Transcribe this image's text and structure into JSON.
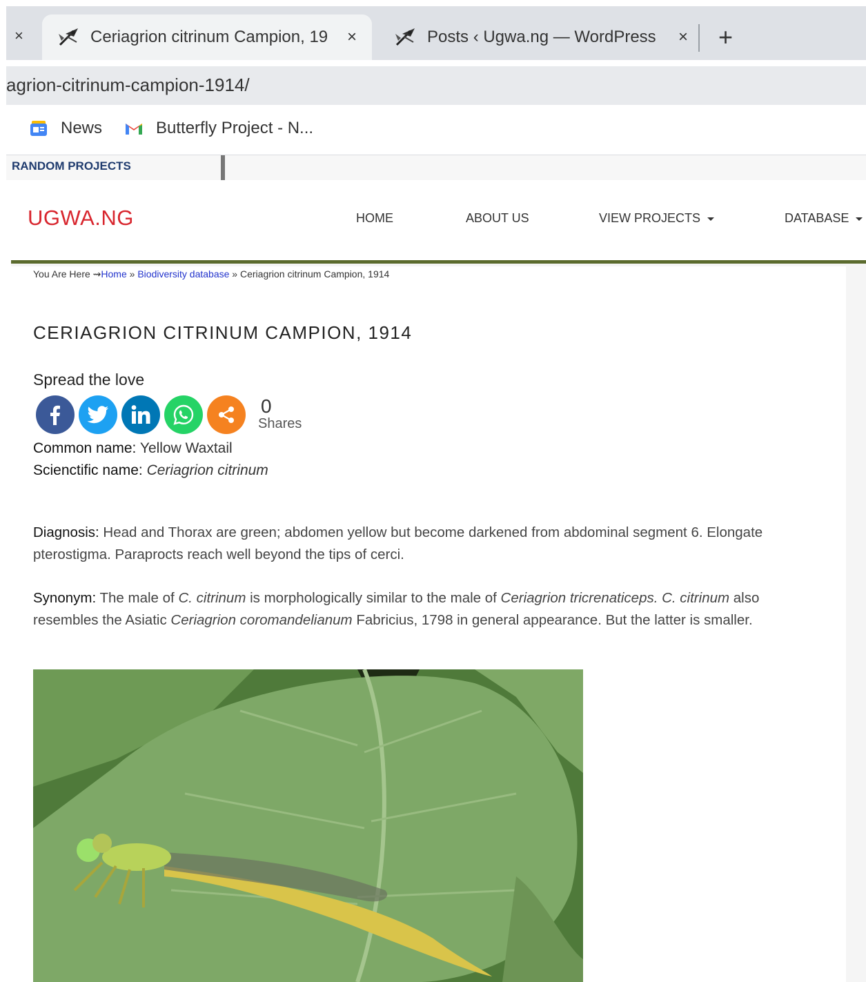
{
  "browser": {
    "tabs": [
      {
        "title": "Ceriagrion citrinum Campion, 19",
        "active": true
      },
      {
        "title": "Posts ‹ Ugwa.ng — WordPress",
        "active": false
      }
    ],
    "close_glyph": "×",
    "new_tab_glyph": "+",
    "address": "agrion-citrinum-campion-1914/",
    "bookmarks": [
      {
        "label": "News",
        "icon": "google-news-icon"
      },
      {
        "label": "Butterfly Project - N...",
        "icon": "gmail-icon"
      }
    ]
  },
  "topbar": {
    "label": "RANDOM PROJECTS"
  },
  "site": {
    "logo": "UGWA.NG",
    "nav": [
      {
        "label": "HOME",
        "dropdown": false
      },
      {
        "label": "ABOUT US",
        "dropdown": false
      },
      {
        "label": "VIEW PROJECTS",
        "dropdown": true
      },
      {
        "label": "DATABASE",
        "dropdown": true
      }
    ],
    "brand_color": "#d8262e",
    "header_rule_color": "#5b6b2e"
  },
  "breadcrumb": {
    "prefix": "You Are Here ⇝",
    "home": "Home",
    "sep": " » ",
    "section": "Biodiversity database",
    "current": "Ceriagrion citrinum Campion, 1914"
  },
  "article": {
    "title": "CERIAGRION CITRINUM CAMPION, 1914",
    "spread": "Spread the love",
    "share_buttons": [
      {
        "name": "facebook",
        "icon": "facebook-icon",
        "color": "#3b5998"
      },
      {
        "name": "twitter",
        "icon": "twitter-icon",
        "color": "#1da1f2"
      },
      {
        "name": "linkedin",
        "icon": "linkedin-icon",
        "color": "#0077b5"
      },
      {
        "name": "whatsapp",
        "icon": "whatsapp-icon",
        "color": "#25d366"
      },
      {
        "name": "share",
        "icon": "share-icon",
        "color": "#f58220"
      }
    ],
    "shares_count": "0",
    "shares_label": "Shares",
    "common_label": "Common name:",
    "common_value": "Yellow Waxtail",
    "sci_label": "Scienctific name:",
    "sci_value": "Ceriagrion citrinum",
    "diagnosis_label": "Diagnosis:",
    "diagnosis_text": "Head and Thorax are green; abdomen yellow but become darkened from abdominal segment 6. Elongate pterostigma. Paraprocts reach well beyond the tips of cerci.",
    "synonym_label": "Synonym:",
    "synonym_parts": {
      "p1": "The male of ",
      "i1": "C. citrinum",
      "p2": " is morphologically similar to the male of ",
      "i2": "Ceriagrion tricrenaticeps. C. citrinum",
      "p3": " also resembles the Asiatic ",
      "i3": "Ceriagrion coromandelianum",
      "p4": " Fabricius, 1798 in general appearance. But the latter is smaller."
    }
  }
}
